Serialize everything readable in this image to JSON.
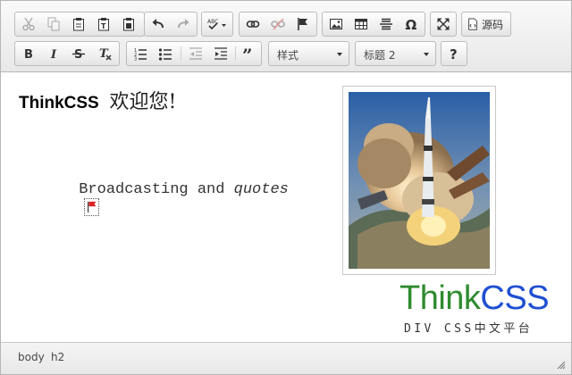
{
  "toolbar": {
    "source_label": "源码",
    "style_combo": "样式",
    "format_combo": "标题 2"
  },
  "content": {
    "heading_latin": "ThinkCSS",
    "heading_cjk": "欢迎您!",
    "para_plain": "Broadcasting and ",
    "para_italic": "quotes"
  },
  "watermark": {
    "think": "Think",
    "css": "CSS",
    "tagline": "DIV CSS中文平台"
  },
  "elements_path": [
    "body",
    "h2"
  ],
  "colors": {
    "think_green": "#2e8b2e",
    "css_blue": "#1f4fd1",
    "toolbar_bg": "#ececec",
    "border": "#b6b6b6"
  }
}
